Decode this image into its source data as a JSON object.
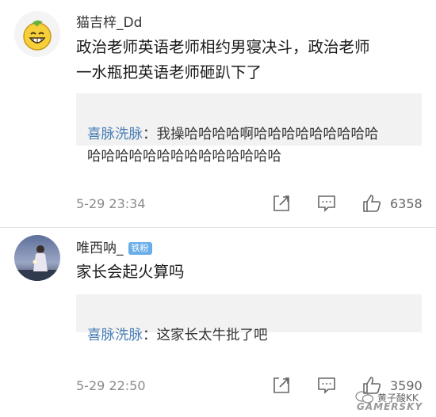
{
  "comments": [
    {
      "username": "猫吉梓_Dd",
      "badge": "",
      "text": "政治老师英语老师相约男寝决斗，政治老师\n一水瓶把英语老师砸趴下了",
      "reply": {
        "author": "喜脉洗脉",
        "separator": "：",
        "text": "我操哈哈哈哈啊哈哈哈哈哈哈哈哈哈\n哈哈哈哈哈哈哈哈哈哈哈哈哈哈"
      },
      "timestamp": "5-29 23:34",
      "likes": "6358"
    },
    {
      "username": "唯西呐_",
      "badge": "铁粉",
      "text": "家长会起火算吗",
      "reply": {
        "author": "喜脉洗脉",
        "separator": "：",
        "text": "这家长太牛批了吧"
      },
      "timestamp": "5-29 22:50",
      "likes": "3590"
    }
  ],
  "icons": {
    "share": "share-icon",
    "comment": "comment-icon",
    "like": "like-icon"
  },
  "watermark": {
    "cn": "黄子酸KK",
    "en": "GAMERSKY"
  },
  "colors": {
    "reply_author": "#4a7fb5",
    "reply_bg": "#f2f2f2",
    "badge": "#6aaee8",
    "meta": "#8a8a8a"
  }
}
